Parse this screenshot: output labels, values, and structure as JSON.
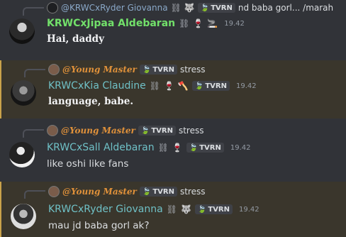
{
  "messages": [
    {
      "reply_name": "@KRWCxRyder Giovanna",
      "reply_tag": "TVRN",
      "reply_text": "nd baba gorl... /marah",
      "author": "KRWCxJipaa Aldebaran",
      "time": "19.42",
      "text": "Hai, daddy"
    },
    {
      "reply_name": "@Young Master",
      "reply_tag": "TVRN",
      "reply_text": "stress",
      "author": "KRWCxKia Claudine",
      "tag": "TVRN",
      "time": "19.42",
      "text": "language, babe."
    },
    {
      "reply_name": "@Young Master",
      "reply_tag": "TVRN",
      "reply_text": "stress",
      "author": "KRWCxSall Aldebaran",
      "tag": "TVRN",
      "time": "19.42",
      "text": "like oshi like fans"
    },
    {
      "reply_name": "@Young Master",
      "reply_tag": "TVRN",
      "reply_text": "stress",
      "author": "KRWCxRyder Giovanna",
      "tag": "TVRN",
      "time": "19.42",
      "text": "mau jd baba gorl ak?"
    }
  ],
  "icons": {
    "chain": "⛓",
    "wine": "🍷",
    "cigarette": "🚬",
    "axe": "🪓",
    "wolf": "🐺",
    "leaf": "🍃"
  },
  "colors": {
    "background": "#313338",
    "highlight_bg": "#3a362c",
    "green_name": "#72e06a",
    "teal_name": "#6fc0c6",
    "gold_name": "#e0913a"
  }
}
